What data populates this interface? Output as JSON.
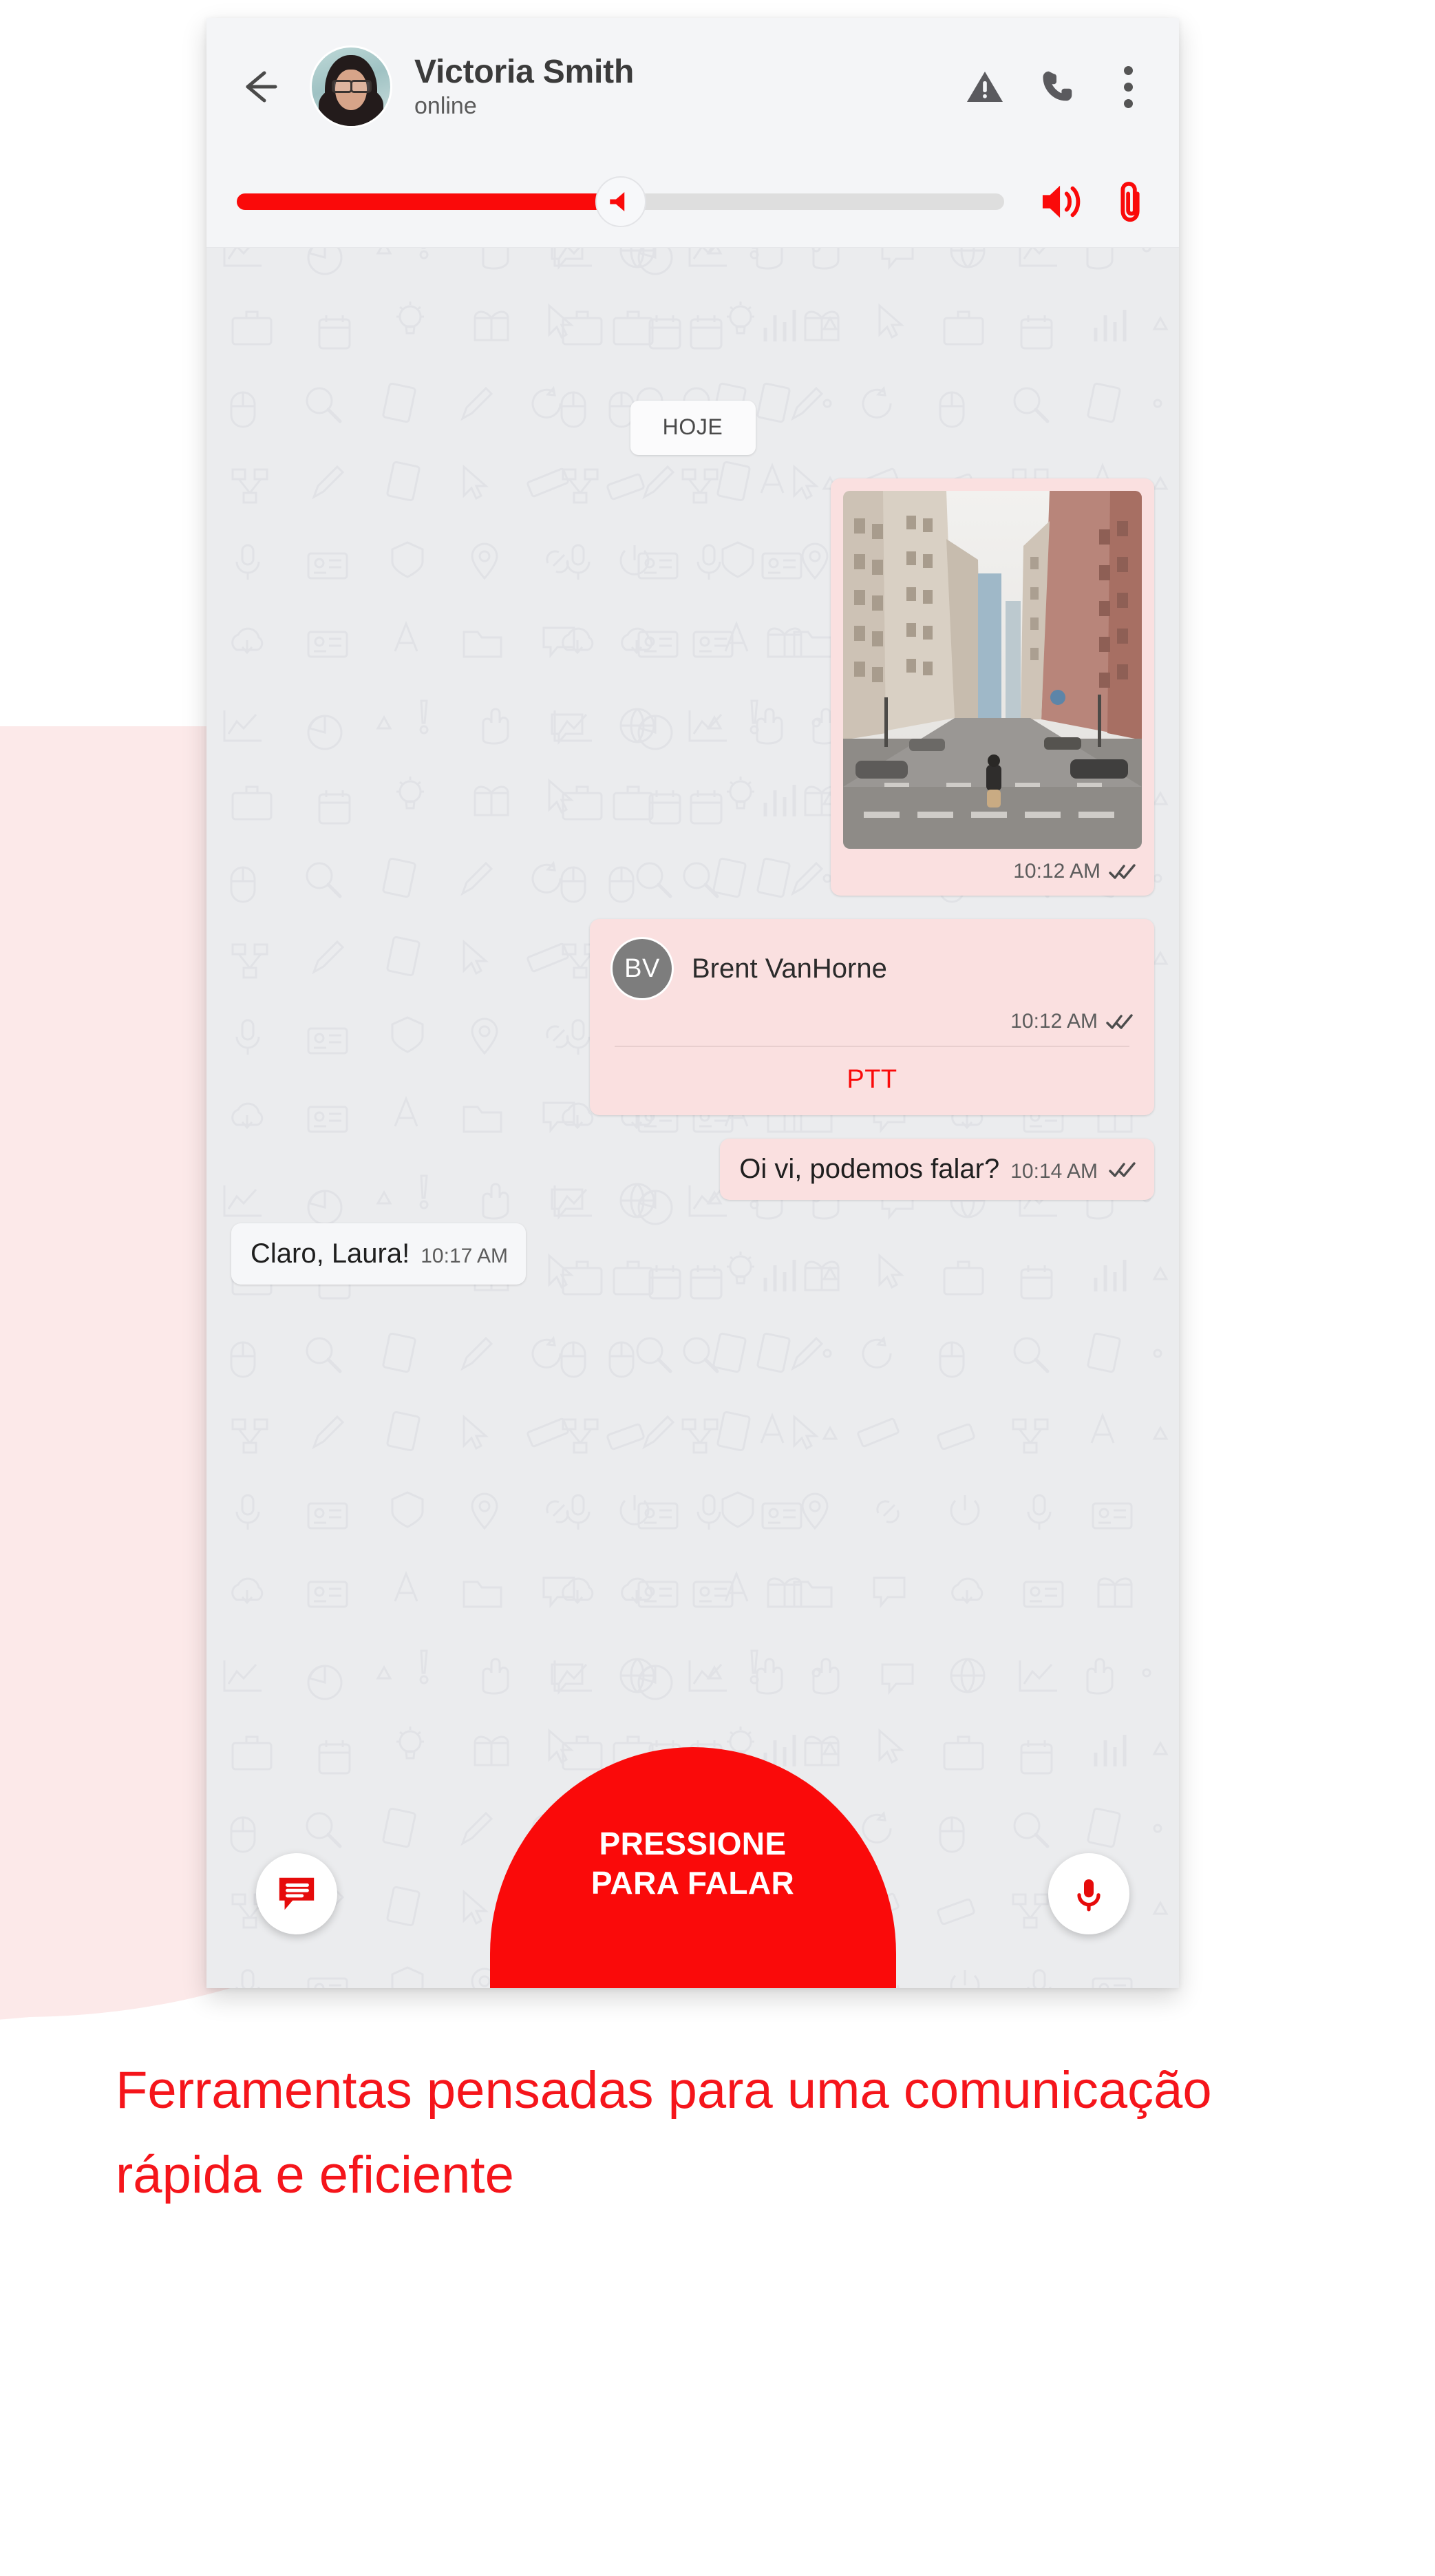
{
  "theme": {
    "brand_red": "#FA0A0A",
    "caption_red": "#F5151B",
    "outgoing_bubble": "#FAE0E0",
    "incoming_bubble": "#F6F7F9",
    "chat_background": "#EBECEE",
    "header_background": "#F4F5F7",
    "blob_pink": "#FCE9E9"
  },
  "header": {
    "back_icon": "back-arrow-icon",
    "avatar": "contact-avatar",
    "contact_name": "Victoria Smith",
    "contact_status": "online",
    "actions": [
      {
        "icon": "alert-triangle-icon",
        "name": "emergency-alert-button"
      },
      {
        "icon": "phone-icon",
        "name": "call-button"
      },
      {
        "icon": "overflow-menu-icon",
        "name": "more-options-button"
      }
    ]
  },
  "volume_bar": {
    "slider": {
      "value_percent": 50,
      "thumb_icon": "speaker-icon"
    },
    "volume_icon": "volume-up-icon",
    "attach_icon": "paperclip-icon"
  },
  "chat": {
    "date_divider": "HOJE",
    "messages": [
      {
        "type": "image",
        "direction": "outgoing",
        "image_alt": "city-street-photo",
        "time": "10:12 AM",
        "status": "read"
      },
      {
        "type": "contact_card",
        "direction": "outgoing",
        "avatar_initials": "BV",
        "name": "Brent VanHorne",
        "time": "10:12 AM",
        "status": "read",
        "action_label": "PTT"
      },
      {
        "type": "text",
        "direction": "outgoing",
        "text": "Oi vi, podemos falar?",
        "time": "10:14 AM",
        "status": "read"
      },
      {
        "type": "text",
        "direction": "incoming",
        "text": "Claro, Laura!",
        "time": "10:17 AM",
        "status": "none"
      }
    ]
  },
  "ptt_controls": {
    "button_line1": "PRESSIONE",
    "button_line2": "PARA FALAR",
    "left_fab_icon": "chat-message-icon",
    "right_fab_icon": "microphone-icon"
  },
  "caption": {
    "text": "Ferramentas pensadas para uma comunicação rápida e eficiente"
  }
}
